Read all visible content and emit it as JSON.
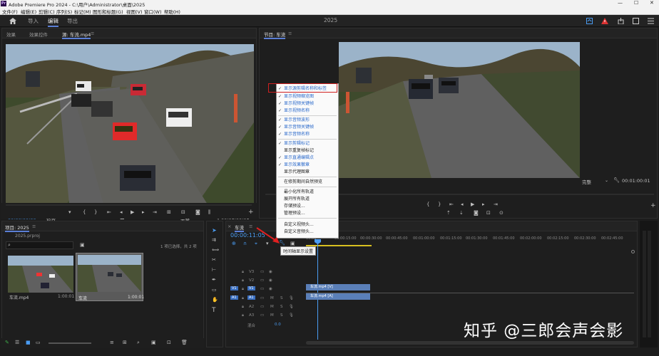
{
  "window": {
    "title": "Adobe Premiere Pro 2024 - C:\\用户\\Administrator\\桌面\\2025",
    "controls": [
      "—",
      "☐",
      "✕"
    ]
  },
  "menu": [
    "文件(F)",
    "编辑(E)",
    "剪辑(C)",
    "序列(S)",
    "标记(M)",
    "图形和标题(G)",
    "视图(V)",
    "窗口(W)",
    "帮助(H)"
  ],
  "workspace": {
    "tabs": [
      "导入",
      "编辑",
      "导出"
    ],
    "active": "编辑",
    "project_name": "2025"
  },
  "source_panel": {
    "tabs": [
      "效果",
      "效果控件",
      "源: 车流.mp4"
    ],
    "timecode_in": "00:00:00:00",
    "fit": "适合",
    "quality": "完整",
    "timecode_out": "00:01:00:01"
  },
  "program_panel": {
    "title": "节目: 车流",
    "quality": "完整",
    "timecode_out": "00:01:00:01"
  },
  "context_menu": {
    "items": [
      {
        "label": "显示源剪辑名称和标签",
        "checked": true
      },
      {
        "label": "显示视频缩览图",
        "checked": true
      },
      {
        "label": "显示视频关键帧",
        "checked": true
      },
      {
        "label": "显示视频名称",
        "checked": true
      },
      {
        "label": "显示音频波形",
        "checked": true
      },
      {
        "label": "显示音频关键帧",
        "checked": true
      },
      {
        "label": "显示音频名称",
        "checked": true
      },
      {
        "label": "显示剪辑标记",
        "checked": true
      },
      {
        "label": "显示重复帧标记",
        "checked": false
      },
      {
        "label": "显示直通编辑点",
        "checked": true
      },
      {
        "label": "显示效果徽章",
        "checked": true
      },
      {
        "label": "显示代理图章",
        "checked": false
      },
      {
        "label": "在修剪期间自然预览",
        "checked": false
      },
      {
        "label": "最小化所有轨道",
        "checked": false
      },
      {
        "label": "展开所有轨道",
        "checked": false
      },
      {
        "label": "存储预设...",
        "checked": false
      },
      {
        "label": "管理预设...",
        "checked": false
      },
      {
        "label": "自定义视频头...",
        "checked": false
      },
      {
        "label": "自定义音频头...",
        "checked": false
      }
    ],
    "check_glyph": "✓"
  },
  "tooltip": "时间轴显示设置",
  "project_panel": {
    "title": "项目: 2025",
    "file": "2025.prproj",
    "selection": "1 项已选择，共 2 项",
    "items": [
      {
        "name": "车流.mp4",
        "duration": "1:00:01"
      },
      {
        "name": "车流",
        "duration": "1:00:01"
      }
    ]
  },
  "timeline": {
    "tab": "车流",
    "timecode": "00:00:11:05",
    "ruler": [
      "00:00",
      "00:00:15:00",
      "00:00:30:00",
      "00:00:45:00",
      "00:01:00:00",
      "00:01:15:00",
      "00:01:30:00",
      "00:01:45:00",
      "00:02:00:00",
      "00:02:15:00",
      "00:02:30:00",
      "00:02:45:00",
      "00:03:00:00",
      "00:03:15:00"
    ],
    "video_tracks": [
      "V3",
      "V2",
      "V1"
    ],
    "audio_tracks": [
      "A1",
      "A2",
      "A3"
    ],
    "source_patch_v": "V1",
    "source_patch_a": "A1",
    "mix_label": "混合",
    "mix_value": "0.0",
    "track_btn_m": "M",
    "track_btn_s": "S",
    "clip_video": "车流.mp4 [V]",
    "clip_audio": "车流.mp4 [A]"
  },
  "watermark": "知乎 @三郎会声会影",
  "colors": {
    "accent": "#4a9cf2",
    "highlight_box": "#d02020",
    "clip_blue": "#5a7fb8"
  },
  "icons": [
    "home-icon",
    "search-icon",
    "wrench-icon",
    "play-icon",
    "marker-icon",
    "camera-icon",
    "selection-tool-icon",
    "razor-tool-icon",
    "hand-tool-icon",
    "type-tool-icon",
    "eye-icon",
    "lock-icon",
    "mic-icon"
  ]
}
